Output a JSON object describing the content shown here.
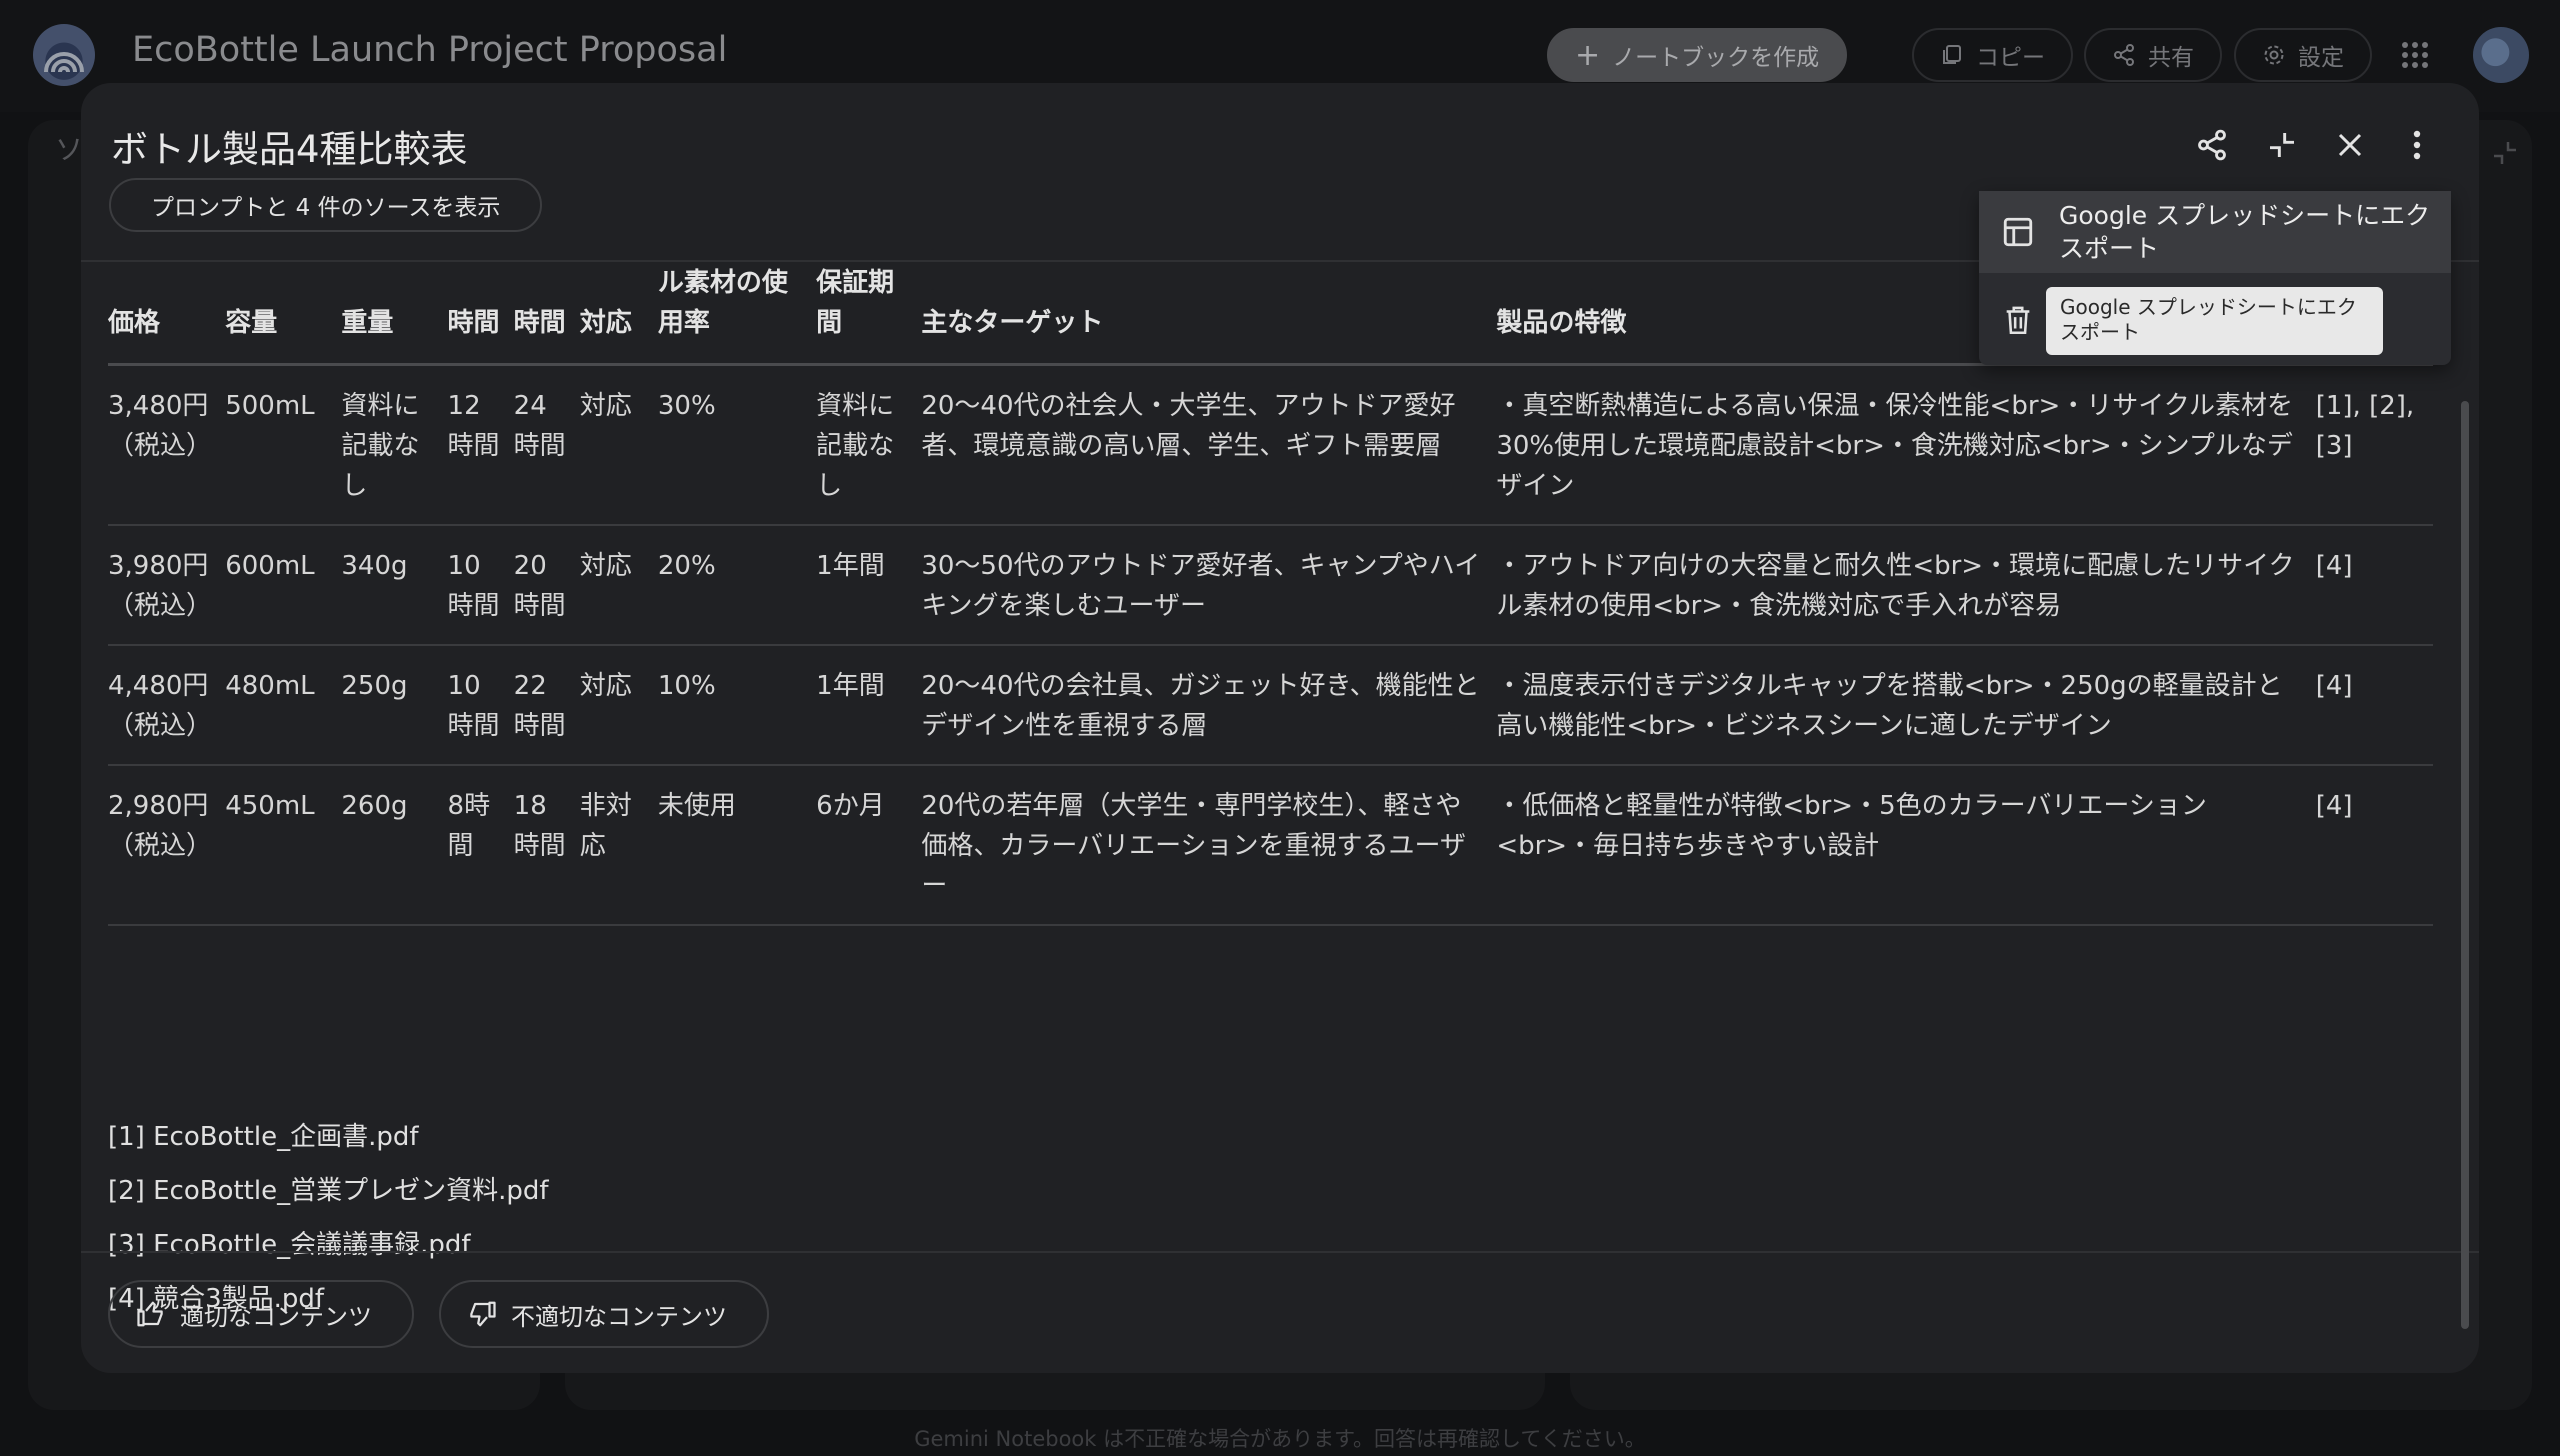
{
  "app": {
    "title": "EcoBottle Launch Project Proposal",
    "create_notebook_label": "ノートブックを作成",
    "copy_label": "コピー",
    "share_label": "共有",
    "settings_label": "設定",
    "footer_note": "Gemini Notebook は不正確な場合があります。回答は再確認してください。",
    "bg_fragment": "ソ"
  },
  "modal": {
    "title": "ボトル製品4種比較表",
    "sources_chip": "プロンプトと 4 件のソースを表示",
    "table": {
      "headers": [
        "価格",
        "容量",
        "重量",
        "時間",
        "時間",
        "対応",
        "ル素材の使用率",
        "保証期間",
        "主なターゲット",
        "製品の特徴",
        ""
      ],
      "rows": [
        [
          "3,480円（税込）",
          "500mL",
          "資料に記載なし",
          "12時間",
          "24時間",
          "対応",
          "30%",
          "資料に記載なし",
          "20〜40代の社会人・大学生、アウトドア愛好者、環境意識の高い層、学生、ギフト需要層",
          "・真空断熱構造による高い保温・保冷性能<br>・リサイクル素材を30%使用した環境配慮設計<br>・食洗機対応<br>・シンプルなデザイン",
          "[1], [2], [3]"
        ],
        [
          "3,980円（税込）",
          "600mL",
          "340g",
          "10時間",
          "20時間",
          "対応",
          "20%",
          "1年間",
          "30〜50代のアウトドア愛好者、キャンプやハイキングを楽しむユーザー",
          "・アウトドア向けの大容量と耐久性<br>・環境に配慮したリサイクル素材の使用<br>・食洗機対応で手入れが容易",
          "[4]"
        ],
        [
          "4,480円（税込）",
          "480mL",
          "250g",
          "10時間",
          "22時間",
          "対応",
          "10%",
          "1年間",
          "20〜40代の会社員、ガジェット好き、機能性とデザイン性を重視する層",
          "・温度表示付きデジタルキャップを搭載<br>・250gの軽量設計と高い機能性<br>・ビジネスシーンに適したデザイン",
          "[4]"
        ],
        [
          "2,980円（税込）",
          "450mL",
          "260g",
          "8時間",
          "18時間",
          "非対応",
          "未使用",
          "6か月",
          "20代の若年層（大学生・専門学校生）、軽さや価格、カラーバリエーションを重視するユーザー",
          "・低価格と軽量性が特徴<br>・5色のカラーバリエーション<br>・毎日持ち歩きやすい設計",
          "[4]"
        ]
      ]
    },
    "references": [
      "[1] EcoBottle_企画書.pdf",
      "[2] EcoBottle_営業プレゼン資料.pdf",
      "[3] EcoBottle_会議議事録.pdf",
      "[4] 競合3製品.pdf"
    ],
    "feedback": {
      "good_label": "適切なコンテンツ",
      "bad_label": "不適切なコンテンツ"
    }
  },
  "menu": {
    "export_label": "Google スプレッドシートにエクスポート",
    "tooltip": "Google スプレッドシートにエクスポート"
  },
  "icons": {
    "share": "share-icon",
    "collapse": "collapse-icon",
    "close": "close-icon",
    "more": "more-vert-icon",
    "table": "table-icon",
    "trash": "trash-icon",
    "thumb_up": "thumb-up-icon",
    "thumb_down": "thumb-down-icon"
  }
}
